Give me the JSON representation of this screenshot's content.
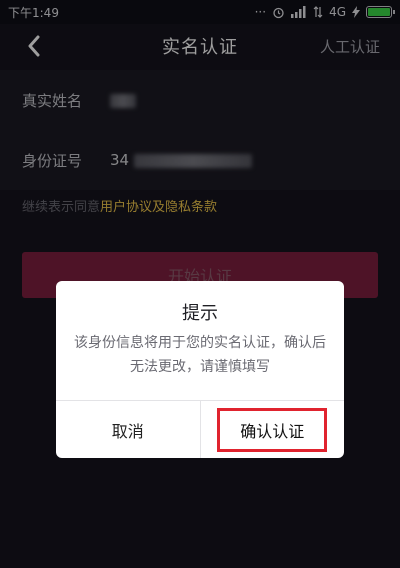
{
  "status_bar": {
    "time": "下午1:49",
    "network": "4G"
  },
  "nav": {
    "title": "实名认证",
    "right_action": "人工认证"
  },
  "form": {
    "name_label": "真实姓名",
    "id_label": "身份证号",
    "id_value_prefix": "34"
  },
  "agreement": {
    "prefix": "继续表示同意",
    "link": "用户协议及隐私条款"
  },
  "start_button": {
    "label": "开始认证"
  },
  "dialog": {
    "title": "提示",
    "message": "该身份信息将用于您的实名认证，确认后无法更改，请谨慎填写",
    "cancel_label": "取消",
    "confirm_label": "确认认证"
  },
  "colors": {
    "background": "#15141d",
    "accent": "#f2c94c",
    "start_button": "#7e2040",
    "highlight_box": "#e0232e"
  }
}
